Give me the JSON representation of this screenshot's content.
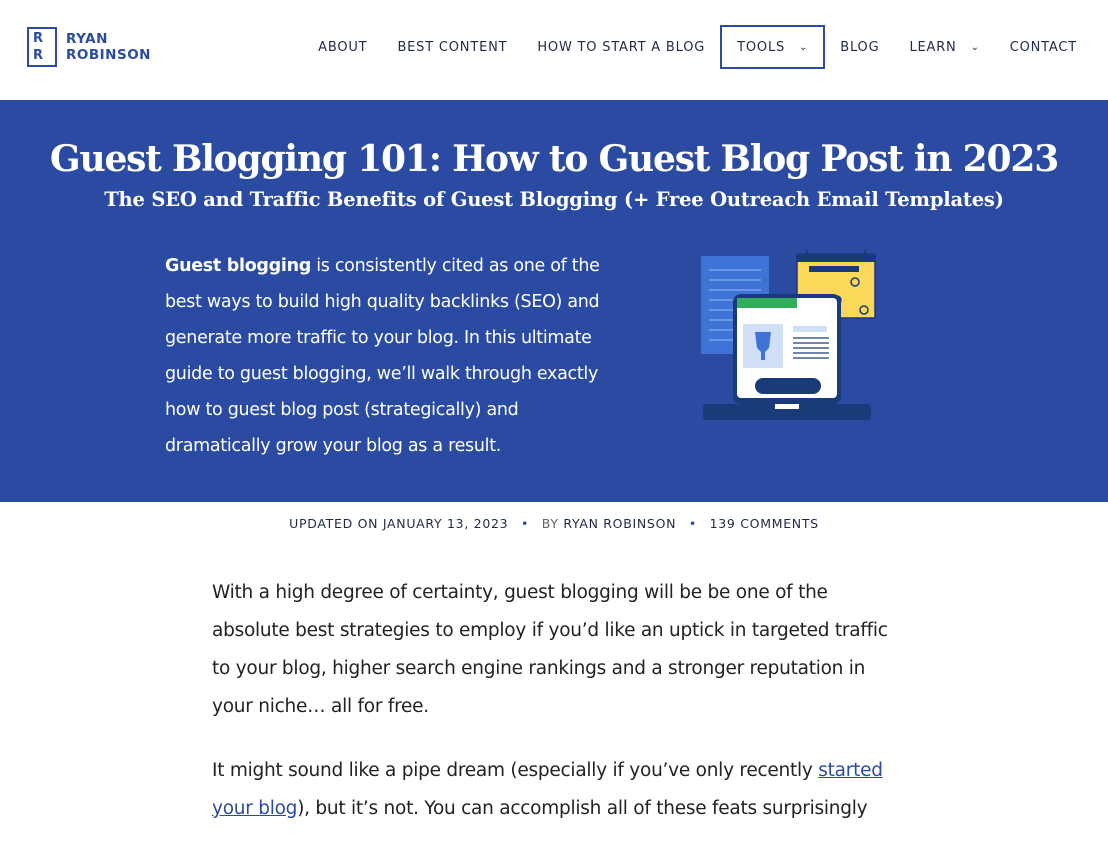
{
  "logo": {
    "line1": "RYAN",
    "line2": "ROBINSON",
    "mark": "R"
  },
  "nav": {
    "items": [
      {
        "label": "ABOUT"
      },
      {
        "label": "BEST CONTENT"
      },
      {
        "label": "HOW TO START A BLOG"
      },
      {
        "label": "TOOLS"
      },
      {
        "label": "BLOG"
      },
      {
        "label": "LEARN"
      },
      {
        "label": "CONTACT"
      }
    ],
    "active": "TOOLS",
    "chevron": "⌄"
  },
  "hero": {
    "title": "Guest Blogging 101: How to Guest Blog Post in 2023",
    "subtitle": "The SEO and Traffic Benefits of Guest Blogging (+ Free Outreach Email Templates)",
    "intro_bold": "Guest blogging",
    "intro_rest": " is consistently cited as one of the best ways to build high quality backlinks (SEO) and generate more traffic to your blog. In this ultimate guide to guest blogging, we’ll walk through exactly how to guest blog post (strategically) and dramatically grow your blog as a result.",
    "illustration": "laptop-calendar-illustration"
  },
  "meta": {
    "updated_label": "UPDATED ON",
    "date": "JANUARY 13, 2023",
    "by": "BY",
    "author": "RYAN ROBINSON",
    "comments": "139 COMMENTS",
    "separator": "•"
  },
  "content": {
    "p1": "With a high degree of certainty, guest blogging will be be one of the absolute best strategies to employ if you’d like an uptick in targeted traffic to your blog, higher search engine rankings and a stronger reputation in your niche… all for free.",
    "p2_before": "It might sound like a pipe dream (especially if you’ve only recently ",
    "p2_link": "started your blog",
    "p2_after": "), but it’s not. You can accomplish all of these feats surprisingly"
  },
  "colors": {
    "brand": "#2a4ba1",
    "text": "#222222"
  }
}
